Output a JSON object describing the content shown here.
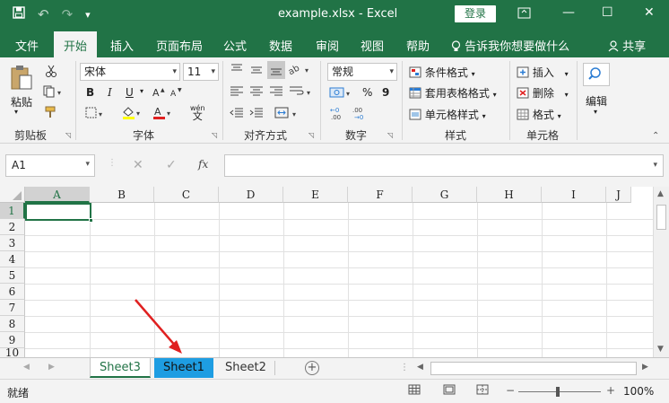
{
  "window": {
    "title": "example.xlsx  -  Excel",
    "login_label": "登录",
    "minimize": "—",
    "restore": "☐",
    "close": "✕"
  },
  "qat": {
    "save": "💾",
    "undo": "↶",
    "redo": "↷",
    "customize": "▾"
  },
  "tabs": {
    "file": "文件",
    "home": "开始",
    "insert": "插入",
    "page_layout": "页面布局",
    "formulas": "公式",
    "data": "数据",
    "review": "审阅",
    "view": "视图",
    "help": "帮助",
    "tell_me": "告诉我你想要做什么",
    "share": "共享"
  },
  "ribbon": {
    "clipboard": {
      "paste": "粘贴",
      "label": "剪贴板"
    },
    "font": {
      "name": "宋体",
      "size": "11",
      "bold": "B",
      "italic": "I",
      "underline": "U",
      "label": "字体",
      "wen": "wén",
      "wen_char": "文"
    },
    "alignment": {
      "label": "对齐方式"
    },
    "number": {
      "format": "常规",
      "percent": "%",
      "comma": "9",
      "label": "数字"
    },
    "styles": {
      "cond_format": "条件格式",
      "table_format": "套用表格格式",
      "cell_style": "单元格样式",
      "label": "样式"
    },
    "cells": {
      "insert": "插入",
      "delete": "删除",
      "format": "格式",
      "label": "单元格"
    },
    "editing": {
      "label": "编辑"
    }
  },
  "formula_bar": {
    "name_box": "A1",
    "cancel": "✕",
    "enter": "✓",
    "fx": "fx"
  },
  "grid": {
    "columns": [
      "A",
      "B",
      "C",
      "D",
      "E",
      "F",
      "G",
      "H",
      "I",
      "J"
    ],
    "rows": [
      "1",
      "2",
      "3",
      "4",
      "5",
      "6",
      "7",
      "8",
      "9",
      "10"
    ],
    "active_cell": "A1"
  },
  "sheets": [
    "Sheet3",
    "Sheet1",
    "Sheet2"
  ],
  "status": {
    "ready": "就绪",
    "zoom": "100%",
    "zoom_minus": "−",
    "zoom_plus": "+"
  },
  "colors": {
    "accent": "#217346",
    "tab_highlight": "#1e9de2",
    "arrow": "#e02020"
  }
}
